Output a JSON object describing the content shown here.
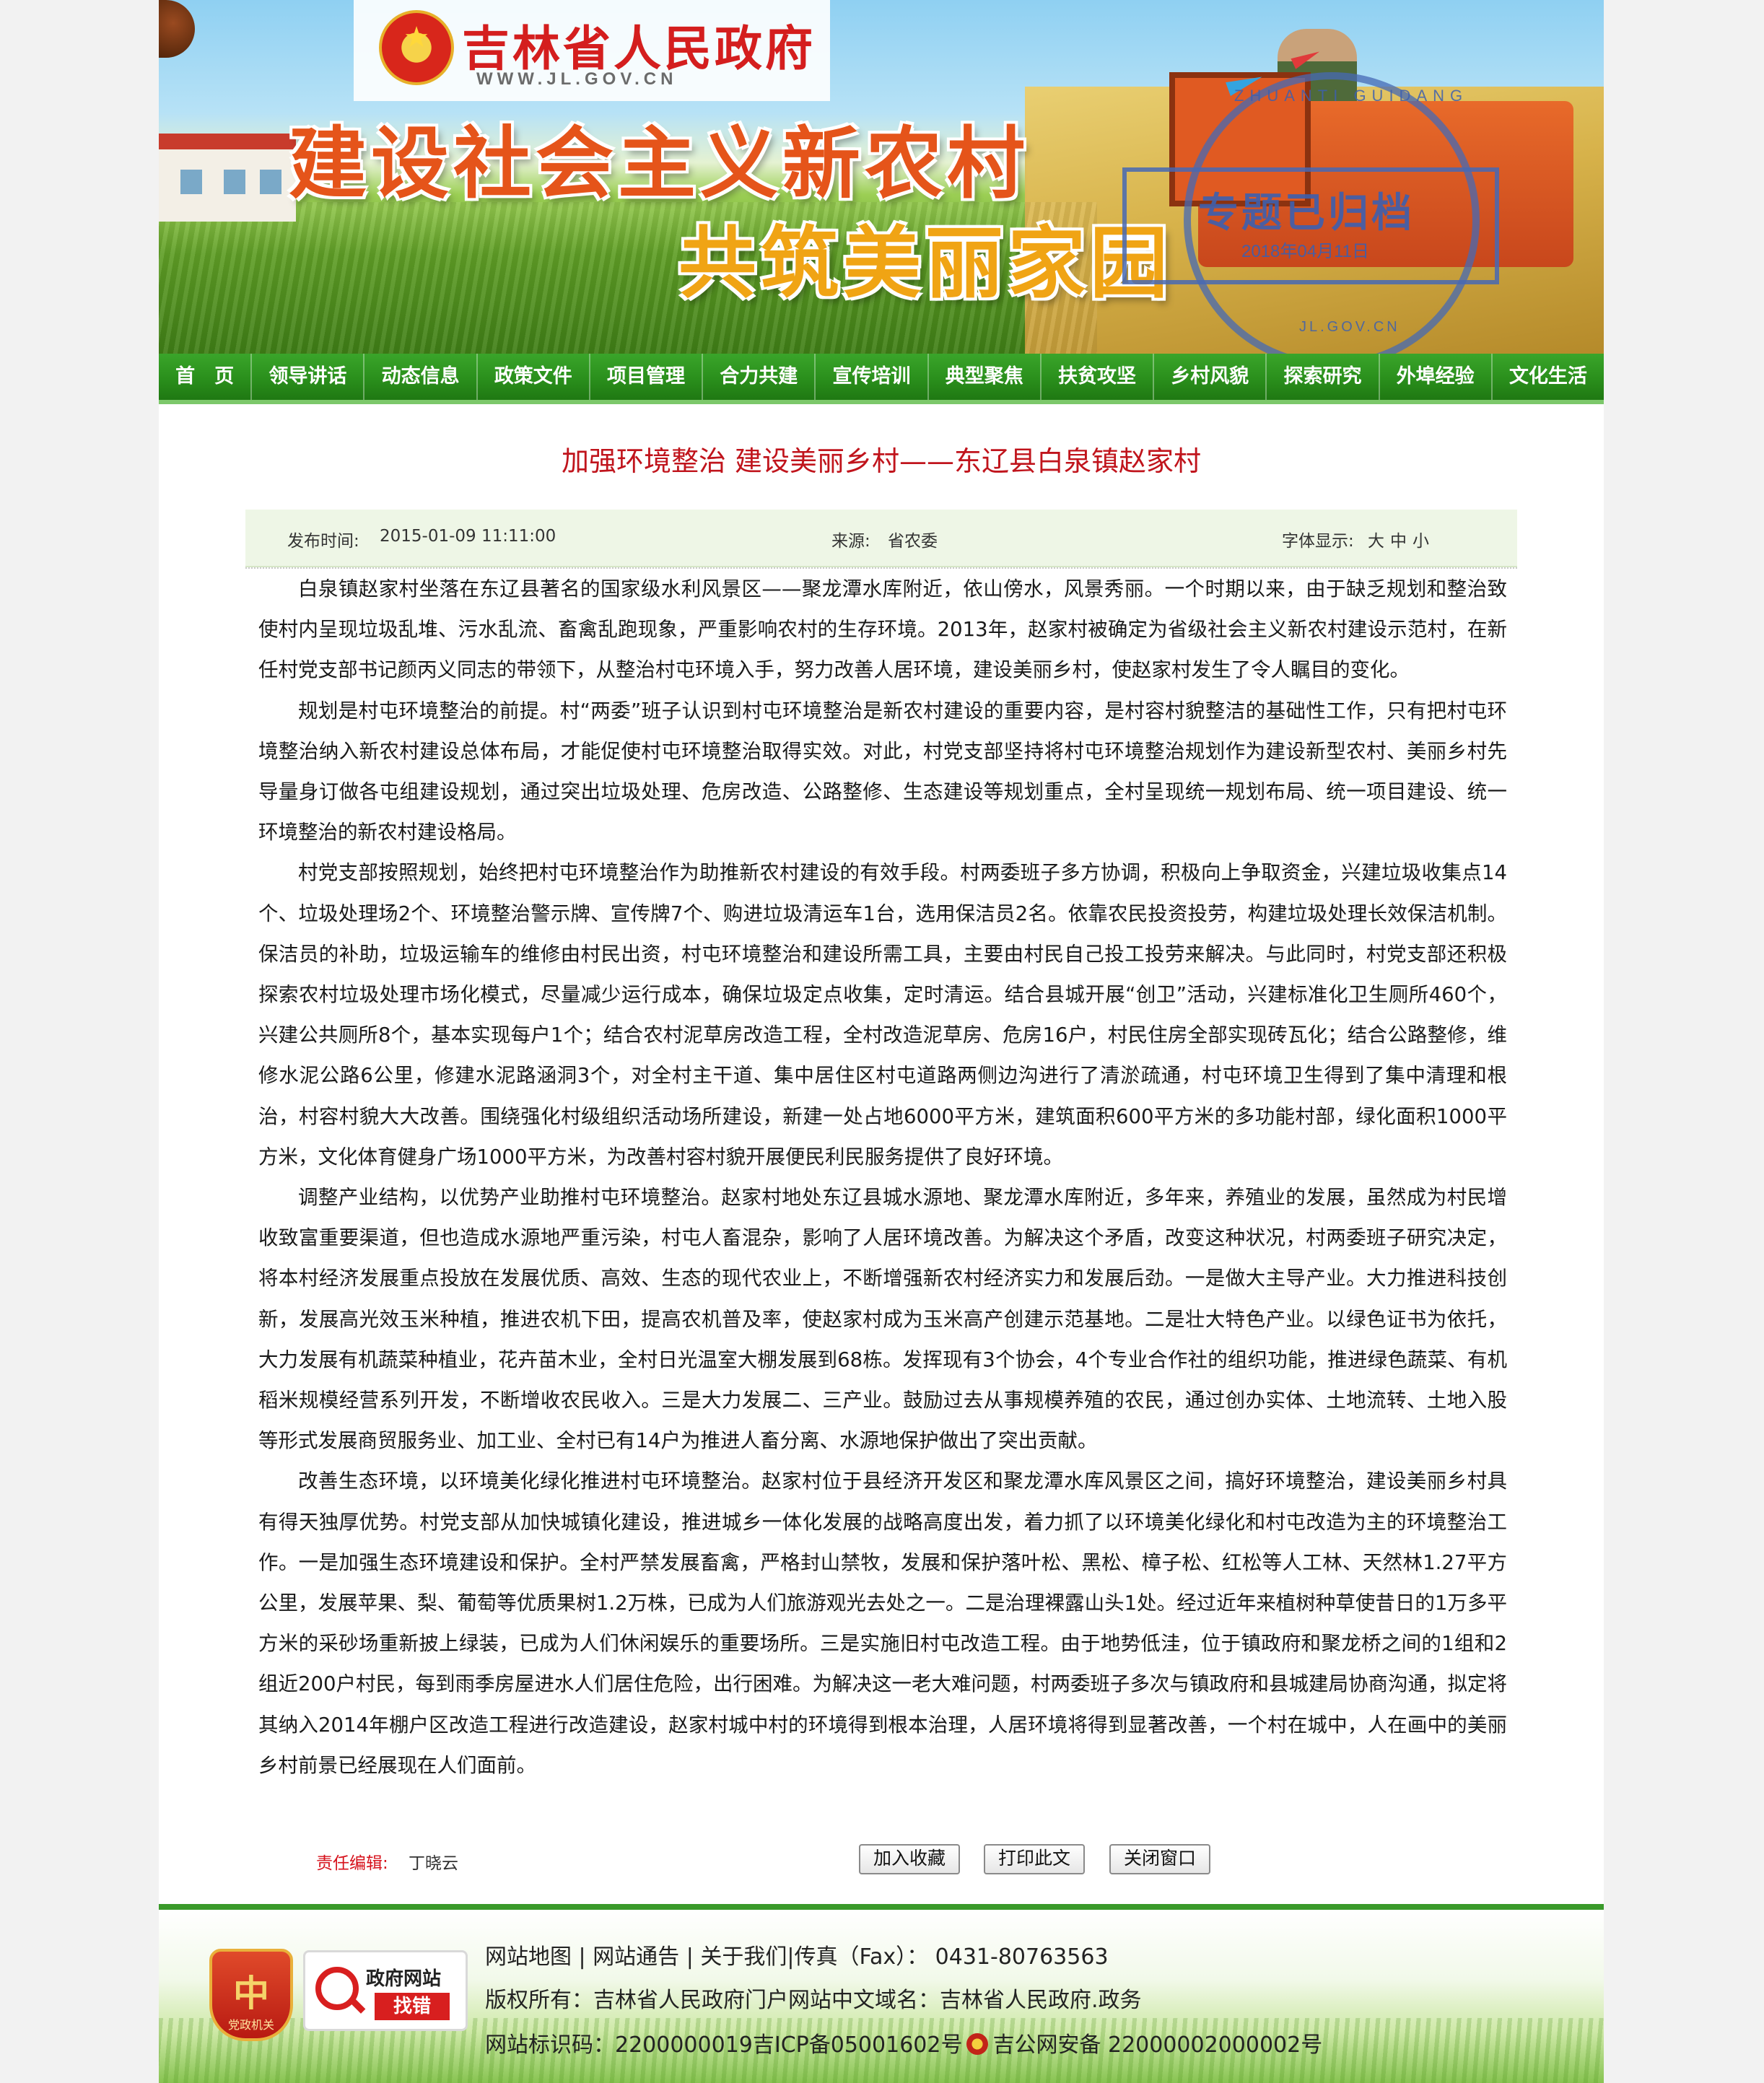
{
  "header": {
    "site_name": "吉林省人民政府",
    "site_url": "WWW.JL.GOV.CN",
    "slogan_line1": "建设社会主义新农村",
    "slogan_line2": "共筑美丽家园",
    "archive_stamp": {
      "title": "专题已归档",
      "date": "2018年04月11日",
      "arc_text": "ZHUANTI GUIDANG",
      "bottom_text": "JL.GOV.CN"
    }
  },
  "nav": {
    "items": [
      {
        "label": "首　页"
      },
      {
        "label": "领导讲话"
      },
      {
        "label": "动态信息"
      },
      {
        "label": "政策文件"
      },
      {
        "label": "项目管理"
      },
      {
        "label": "合力共建"
      },
      {
        "label": "宣传培训"
      },
      {
        "label": "典型聚焦"
      },
      {
        "label": "扶贫攻坚"
      },
      {
        "label": "乡村风貌"
      },
      {
        "label": "探索研究"
      },
      {
        "label": "外埠经验"
      },
      {
        "label": "文化生活"
      }
    ]
  },
  "article": {
    "title": "加强环境整治 建设美丽乡村——东辽县白泉镇赵家村",
    "meta": {
      "publish_label": "发布时间:",
      "publish_time": "2015-01-09 11:11:00",
      "source_label": "来源:",
      "source": "省农委",
      "font_label": "字体显示:",
      "font_large": "大",
      "font_medium": "中",
      "font_small": "小"
    },
    "paragraphs": [
      "白泉镇赵家村坐落在东辽县著名的国家级水利风景区——聚龙潭水库附近，依山傍水，风景秀丽。一个时期以来，由于缺乏规划和整治致使村内呈现垃圾乱堆、污水乱流、畜禽乱跑现象，严重影响农村的生存环境。2013年，赵家村被确定为省级社会主义新农村建设示范村，在新任村党支部书记颜丙义同志的带领下，从整治村屯环境入手，努力改善人居环境，建设美丽乡村，使赵家村发生了令人瞩目的变化。",
      "规划是村屯环境整治的前提。村“两委”班子认识到村屯环境整治是新农村建设的重要内容，是村容村貌整洁的基础性工作，只有把村屯环境整治纳入新农村建设总体布局，才能促使村屯环境整治取得实效。对此，村党支部坚持将村屯环境整治规划作为建设新型农村、美丽乡村先导量身订做各屯组建设规划，通过突出垃圾处理、危房改造、公路整修、生态建设等规划重点，全村呈现统一规划布局、统一项目建设、统一环境整治的新农村建设格局。",
      "村党支部按照规划，始终把村屯环境整治作为助推新农村建设的有效手段。村两委班子多方协调，积极向上争取资金，兴建垃圾收集点14个、垃圾处理场2个、环境整治警示牌、宣传牌7个、购进垃圾清运车1台，选用保洁员2名。依靠农民投资投劳，构建垃圾处理长效保洁机制。保洁员的补助，垃圾运输车的维修由村民出资，村屯环境整治和建设所需工具，主要由村民自己投工投劳来解决。与此同时，村党支部还积极探索农村垃圾处理市场化模式，尽量减少运行成本，确保垃圾定点收集，定时清运。结合县城开展“创卫”活动，兴建标准化卫生厕所460个，兴建公共厕所8个，基本实现每户1个；结合农村泥草房改造工程，全村改造泥草房、危房16户，村民住房全部实现砖瓦化；结合公路整修，维修水泥公路6公里，修建水泥路涵洞3个，对全村主干道、集中居住区村屯道路两侧边沟进行了清淤疏通，村屯环境卫生得到了集中清理和根治，村容村貌大大改善。围绕强化村级组织活动场所建设，新建一处占地6000平方米，建筑面积600平方米的多功能村部，绿化面积1000平方米，文化体育健身广场1000平方米，为改善村容村貌开展便民利民服务提供了良好环境。",
      "调整产业结构，以优势产业助推村屯环境整治。赵家村地处东辽县城水源地、聚龙潭水库附近，多年来，养殖业的发展，虽然成为村民增收致富重要渠道，但也造成水源地严重污染，村屯人畜混杂，影响了人居环境改善。为解决这个矛盾，改变这种状况，村两委班子研究决定，将本村经济发展重点投放在发展优质、高效、生态的现代农业上，不断增强新农村经济实力和发展后劲。一是做大主导产业。大力推进科技创新，发展高光效玉米种植，推进农机下田，提高农机普及率，使赵家村成为玉米高产创建示范基地。二是壮大特色产业。以绿色证书为依托，大力发展有机蔬菜种植业，花卉苗木业，全村日光温室大棚发展到68栋。发挥现有3个协会，4个专业合作社的组织功能，推进绿色蔬菜、有机稻米规模经营系列开发，不断增收农民收入。三是大力发展二、三产业。鼓励过去从事规模养殖的农民，通过创办实体、土地流转、土地入股等形式发展商贸服务业、加工业、全村已有14户为推进人畜分离、水源地保护做出了突出贡献。",
      "改善生态环境，以环境美化绿化推进村屯环境整治。赵家村位于县经济开发区和聚龙潭水库风景区之间，搞好环境整治，建设美丽乡村具有得天独厚优势。村党支部从加快城镇化建设，推进城乡一体化发展的战略高度出发，着力抓了以环境美化绿化和村屯改造为主的环境整治工作。一是加强生态环境建设和保护。全村严禁发展畜禽，严格封山禁牧，发展和保护落叶松、黑松、樟子松、红松等人工林、天然林1.27平方公里，发展苹果、梨、葡萄等优质果树1.2万株，已成为人们旅游观光去处之一。二是治理裸露山头1处。经过近年来植树种草使昔日的1万多平方米的采砂场重新披上绿装，已成为人们休闲娱乐的重要场所。三是实施旧村屯改造工程。由于地势低洼，位于镇政府和聚龙桥之间的1组和2组近200户村民，每到雨季房屋进水人们居住危险，出行困难。为解决这一老大难问题，村两委班子多次与镇政府和县城建局协商沟通，拟定将其纳入2014年棚户区改造工程进行改造建设，赵家村城中村的环境得到根本治理，人居环境将得到显著改善，一个村在城中，人在画中的美丽乡村前景已经展现在人们面前。"
    ],
    "editor_label": "责任编辑:",
    "editor_name": "丁晓云",
    "buttons": {
      "favorite": "加入收藏",
      "print": "打印此文",
      "close": "关闭窗口"
    }
  },
  "footer": {
    "badge_text": "党政机关",
    "badge_glyph": "中",
    "jiucuo_line1": "政府网站",
    "jiucuo_line2": "找错",
    "links": {
      "sitemap": "网站地图",
      "notice": "网站通告",
      "about": "关于我们",
      "fax": "|传真（Fax）：  0431-80763563"
    },
    "copyright": "版权所有：吉林省人民政府门户网站中文域名：吉林省人民政府.政务",
    "site_code": "网站标识码：2200000019吉ICP备05001602号",
    "police_record": "吉公网安备 22000002000002号"
  }
}
